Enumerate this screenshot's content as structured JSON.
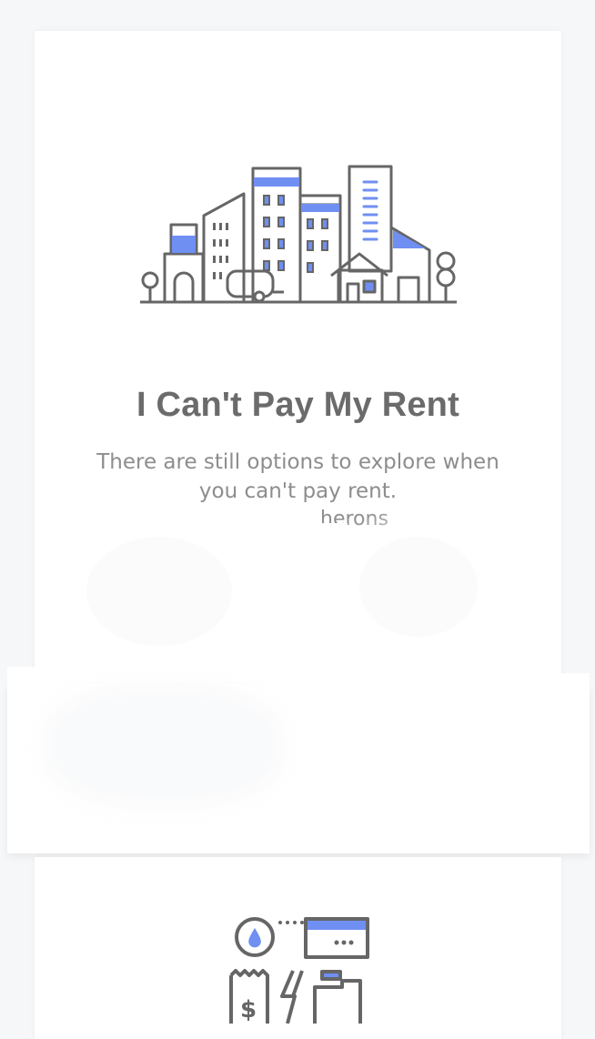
{
  "hero": {
    "title": "I Can't Pay My Rent",
    "subtitle": "There are still options to explore when you can't pay rent.",
    "stray_word": "herons",
    "illustration_icon": "city-buildings-icon"
  },
  "next_card": {
    "illustration_icon": "utility-bills-icon"
  },
  "colors": {
    "background": "#f6f7f9",
    "card": "#ffffff",
    "title": "#6b6b6b",
    "subtitle": "#8d8d8d",
    "accent": "#6f8ff2",
    "line": "#666666"
  }
}
